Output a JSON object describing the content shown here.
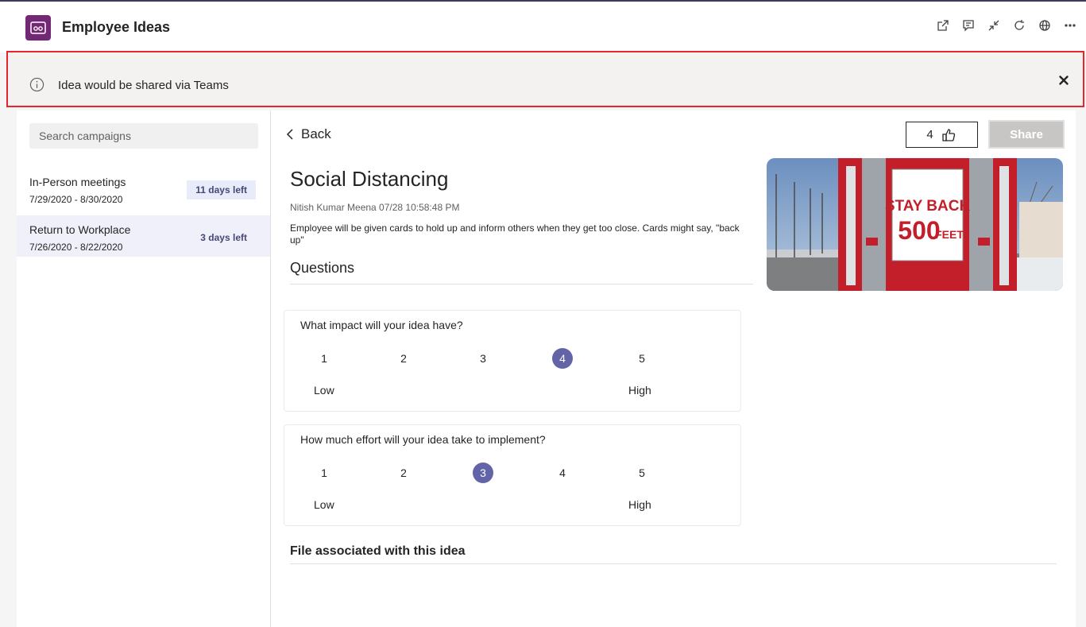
{
  "app": {
    "title": "Employee Ideas"
  },
  "header": {
    "actions": [
      {
        "name": "popout-icon"
      },
      {
        "name": "chat-icon"
      },
      {
        "name": "collapse-icon"
      },
      {
        "name": "refresh-icon"
      },
      {
        "name": "globe-icon"
      },
      {
        "name": "more-icon"
      }
    ]
  },
  "banner": {
    "message": "Idea would be shared via Teams",
    "icon": "info-icon"
  },
  "sidebar": {
    "search_placeholder": "Search campaigns",
    "campaigns": [
      {
        "name": "In-Person meetings",
        "dates": "7/29/2020 - 8/30/2020",
        "badge": "11 days left",
        "selected": false
      },
      {
        "name": "Return to Workplace",
        "dates": "7/26/2020 - 8/22/2020",
        "badge": "3 days left",
        "selected": true
      }
    ]
  },
  "main": {
    "back_label": "Back",
    "like_count": "4",
    "share_label": "Share",
    "idea": {
      "title": "Social Distancing",
      "meta": "Nitish Kumar Meena  07/28 10:58:48 PM",
      "description": "Employee will be given cards to hold up and inform others when they get too close. Cards might say, \"back up\"",
      "image_sign_line1": "STAY BACK",
      "image_sign_line2": "500",
      "image_sign_line3": "FEET"
    },
    "questions_heading": "Questions",
    "questions": [
      {
        "text": "What impact will your idea have?",
        "options": [
          "1",
          "2",
          "3",
          "4",
          "5"
        ],
        "selected": "4",
        "low_label": "Low",
        "high_label": "High"
      },
      {
        "text": "How much effort will your idea take to implement?",
        "options": [
          "1",
          "2",
          "3",
          "4",
          "5"
        ],
        "selected": "3",
        "low_label": "Low",
        "high_label": "High"
      }
    ],
    "file_heading": "File associated with this idea"
  },
  "colors": {
    "accent": "#6264a7",
    "brand": "#742774",
    "banner_border": "#e8242c"
  }
}
